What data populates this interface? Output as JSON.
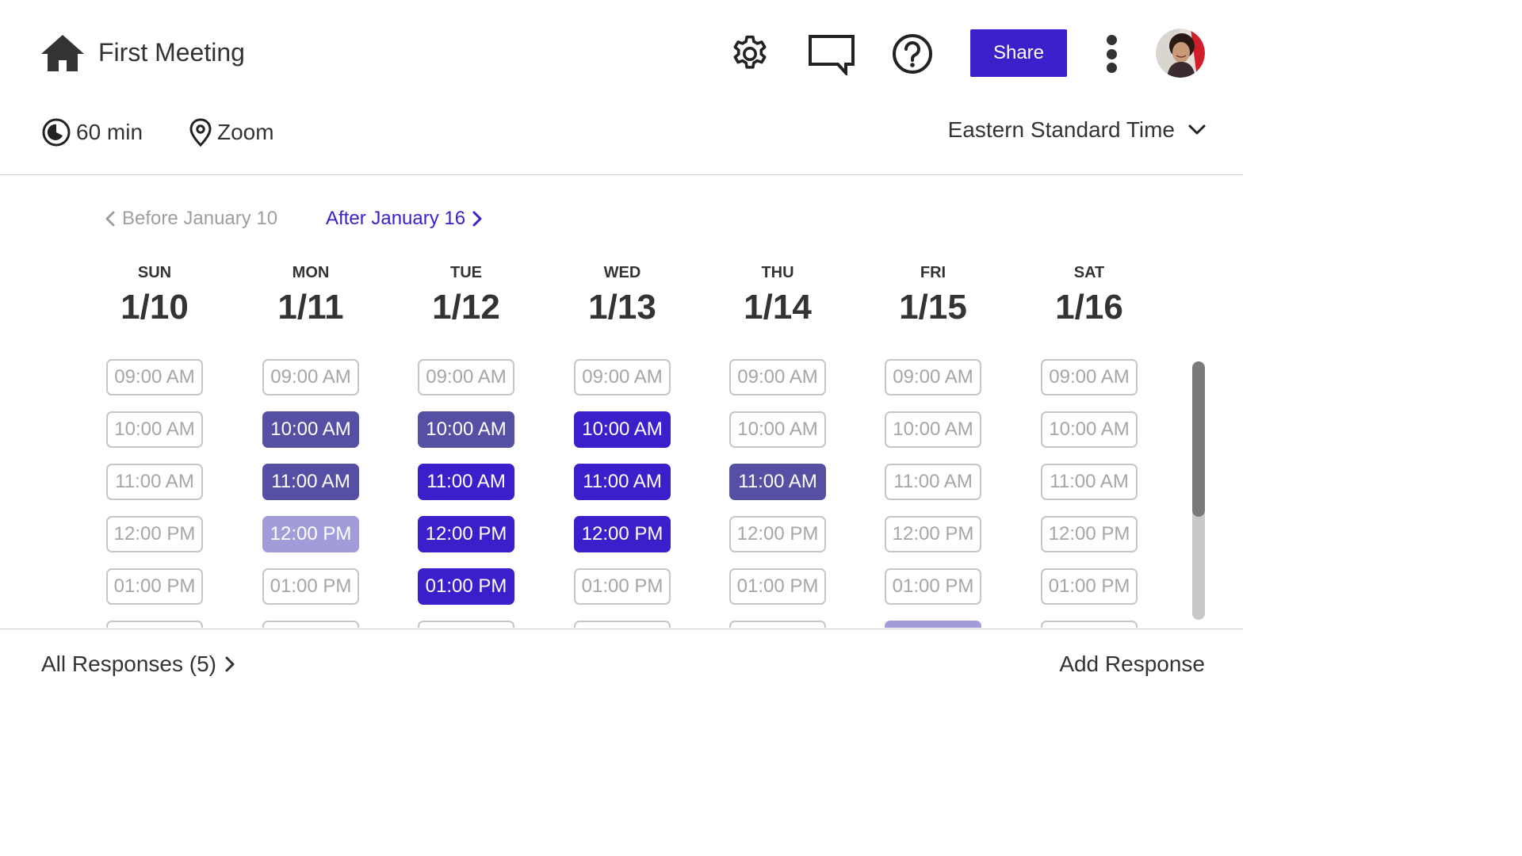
{
  "header": {
    "title": "First Meeting",
    "share_label": "Share"
  },
  "info": {
    "duration": "60 min",
    "location": "Zoom",
    "timezone": "Eastern Standard Time"
  },
  "week_nav": {
    "prev_label": "Before January 10",
    "next_label": "After January 16"
  },
  "colors": {
    "accent": "#3A1FCB",
    "availability_low": "#A39CDA",
    "availability_mid": "#5550A4",
    "availability_high": "#3A1FCB"
  },
  "days": [
    {
      "name": "SUN",
      "date": "1/10",
      "slots": [
        {
          "label": "09:00 AM",
          "state": "empty"
        },
        {
          "label": "10:00 AM",
          "state": "empty"
        },
        {
          "label": "11:00 AM",
          "state": "empty"
        },
        {
          "label": "12:00 PM",
          "state": "empty"
        },
        {
          "label": "01:00 PM",
          "state": "empty"
        },
        {
          "label": "",
          "state": "empty"
        }
      ]
    },
    {
      "name": "MON",
      "date": "1/11",
      "slots": [
        {
          "label": "09:00 AM",
          "state": "empty"
        },
        {
          "label": "10:00 AM",
          "state": "l2"
        },
        {
          "label": "11:00 AM",
          "state": "l2"
        },
        {
          "label": "12:00 PM",
          "state": "l1"
        },
        {
          "label": "01:00 PM",
          "state": "empty"
        },
        {
          "label": "",
          "state": "empty"
        }
      ]
    },
    {
      "name": "TUE",
      "date": "1/12",
      "slots": [
        {
          "label": "09:00 AM",
          "state": "empty"
        },
        {
          "label": "10:00 AM",
          "state": "l2"
        },
        {
          "label": "11:00 AM",
          "state": "l3"
        },
        {
          "label": "12:00 PM",
          "state": "l3"
        },
        {
          "label": "01:00 PM",
          "state": "l3"
        },
        {
          "label": "",
          "state": "empty"
        }
      ]
    },
    {
      "name": "WED",
      "date": "1/13",
      "slots": [
        {
          "label": "09:00 AM",
          "state": "empty"
        },
        {
          "label": "10:00 AM",
          "state": "l3"
        },
        {
          "label": "11:00 AM",
          "state": "l3"
        },
        {
          "label": "12:00 PM",
          "state": "l3"
        },
        {
          "label": "01:00 PM",
          "state": "empty"
        },
        {
          "label": "",
          "state": "empty"
        }
      ]
    },
    {
      "name": "THU",
      "date": "1/14",
      "slots": [
        {
          "label": "09:00 AM",
          "state": "empty"
        },
        {
          "label": "10:00 AM",
          "state": "empty"
        },
        {
          "label": "11:00 AM",
          "state": "l2"
        },
        {
          "label": "12:00 PM",
          "state": "empty"
        },
        {
          "label": "01:00 PM",
          "state": "empty"
        },
        {
          "label": "",
          "state": "empty"
        }
      ]
    },
    {
      "name": "FRI",
      "date": "1/15",
      "slots": [
        {
          "label": "09:00 AM",
          "state": "empty"
        },
        {
          "label": "10:00 AM",
          "state": "empty"
        },
        {
          "label": "11:00 AM",
          "state": "empty"
        },
        {
          "label": "12:00 PM",
          "state": "empty"
        },
        {
          "label": "01:00 PM",
          "state": "empty"
        },
        {
          "label": "",
          "state": "l1"
        }
      ]
    },
    {
      "name": "SAT",
      "date": "1/16",
      "slots": [
        {
          "label": "09:00 AM",
          "state": "empty"
        },
        {
          "label": "10:00 AM",
          "state": "empty"
        },
        {
          "label": "11:00 AM",
          "state": "empty"
        },
        {
          "label": "12:00 PM",
          "state": "empty"
        },
        {
          "label": "01:00 PM",
          "state": "empty"
        },
        {
          "label": "",
          "state": "empty"
        }
      ]
    }
  ],
  "footer": {
    "all_responses_label": "All Responses (5)",
    "add_response_label": "Add Response"
  },
  "icons": {
    "home": "home-icon",
    "settings": "gear-icon",
    "comments": "comment-icon",
    "help": "help-icon",
    "more": "more-vertical-icon",
    "duration": "clock-icon",
    "location": "location-pin-icon",
    "timezone_dropdown": "chevron-down-icon"
  }
}
